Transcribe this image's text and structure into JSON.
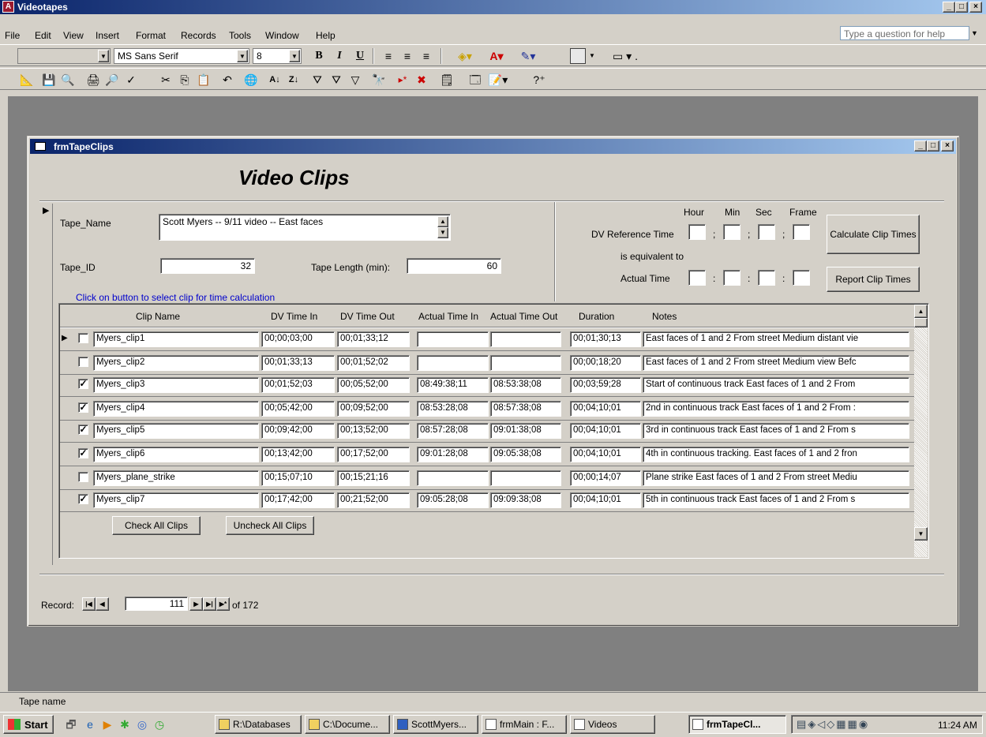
{
  "app": {
    "title": "Videotapes",
    "help_placeholder": "Type a question for help"
  },
  "menu": [
    "File",
    "Edit",
    "View",
    "Insert",
    "Format",
    "Records",
    "Tools",
    "Window",
    "Help"
  ],
  "toolbar": {
    "object_combo": "",
    "font_name": "MS Sans Serif",
    "font_size": "8",
    "bold": "B",
    "italic": "I",
    "underline": "U"
  },
  "form": {
    "window_title": "frmTapeClips",
    "heading": "Video Clips",
    "tape_name_label": "Tape_Name",
    "tape_name_value": "Scott Myers -- 9/11 video -- East faces",
    "tape_id_label": "Tape_ID",
    "tape_id_value": "32",
    "tape_length_label": "Tape Length (min):",
    "tape_length_value": "60",
    "time_headers": {
      "hour": "Hour",
      "min": "Min",
      "sec": "Sec",
      "frame": "Frame"
    },
    "dv_ref_label": "DV Reference Time",
    "equivalent_label": "is equivalent to",
    "actual_time_label": "Actual Time",
    "sep_semicolon": ";",
    "sep_colon": ":",
    "calculate_button": "Calculate Clip Times",
    "report_button": "Report Clip Times",
    "instruction": "Click on button to select clip for time calculation",
    "instruction_color": "#0000cc",
    "columns": [
      "Clip Name",
      "DV Time In",
      "DV Time Out",
      "Actual Time In",
      "Actual Time Out",
      "Duration",
      "Notes"
    ],
    "rows": [
      {
        "checked": false,
        "name": "Myers_clip1",
        "dv_in": "00;00;03;00",
        "dv_out": "00;01;33;12",
        "act_in": "",
        "act_out": "",
        "duration": "00;01;30;13",
        "notes": "East faces of 1 and 2  From street  Medium distant vie"
      },
      {
        "checked": false,
        "name": "Myers_clip2",
        "dv_in": "00;01;33;13",
        "dv_out": "00;01;52;02",
        "act_in": "",
        "act_out": "",
        "duration": "00;00;18;20",
        "notes": "East faces of 1 and 2  From street  Medium view  Befc"
      },
      {
        "checked": true,
        "name": "Myers_clip3",
        "dv_in": "00;01;52;03",
        "dv_out": "00;05;52;00",
        "act_in": "08:49:38;11",
        "act_out": "08:53:38;08",
        "duration": "00;03;59;28",
        "notes": "Start of continuous track  East faces of 1 and 2  From"
      },
      {
        "checked": true,
        "name": "Myers_clip4",
        "dv_in": "00;05;42;00",
        "dv_out": "00;09;52;00",
        "act_in": "08:53:28;08",
        "act_out": "08:57:38;08",
        "duration": "00;04;10;01",
        "notes": "2nd in continuous track  East faces of 1 and 2  From :"
      },
      {
        "checked": true,
        "name": "Myers_clip5",
        "dv_in": "00;09;42;00",
        "dv_out": "00;13;52;00",
        "act_in": "08:57:28;08",
        "act_out": "09:01:38;08",
        "duration": "00;04;10;01",
        "notes": "3rd in continuous track  East faces of 1 and 2  From s"
      },
      {
        "checked": true,
        "name": "Myers_clip6",
        "dv_in": "00;13;42;00",
        "dv_out": "00;17;52;00",
        "act_in": "09:01:28;08",
        "act_out": "09:05:38;08",
        "duration": "00;04;10;01",
        "notes": "4th in continuous tracking.  East faces of 1 and 2 fron"
      },
      {
        "checked": false,
        "name": "Myers_plane_strike",
        "dv_in": "00;15;07;10",
        "dv_out": "00;15;21;16",
        "act_in": "",
        "act_out": "",
        "duration": "00;00;14;07",
        "notes": "Plane strike  East faces of 1 and 2  From street  Mediu"
      },
      {
        "checked": true,
        "name": "Myers_clip7",
        "dv_in": "00;17;42;00",
        "dv_out": "00;21;52;00",
        "act_in": "09:05:28;08",
        "act_out": "09:09:38;08",
        "duration": "00;04;10;01",
        "notes": "5th in continuous track  East faces of 1 and 2  From s"
      }
    ],
    "check_all_button": "Check All Clips",
    "uncheck_all_button": "Uncheck All Clips",
    "record_label": "Record:",
    "record_number": "111",
    "record_total": "of  172"
  },
  "status_text": "Tape name",
  "taskbar": {
    "start": "Start",
    "tasks": [
      "R:\\Databases",
      "C:\\Docume...",
      "ScottMyers...",
      "frmMain : F...",
      "Videos",
      "frmTapeCl..."
    ],
    "clock": "11:24 AM"
  }
}
